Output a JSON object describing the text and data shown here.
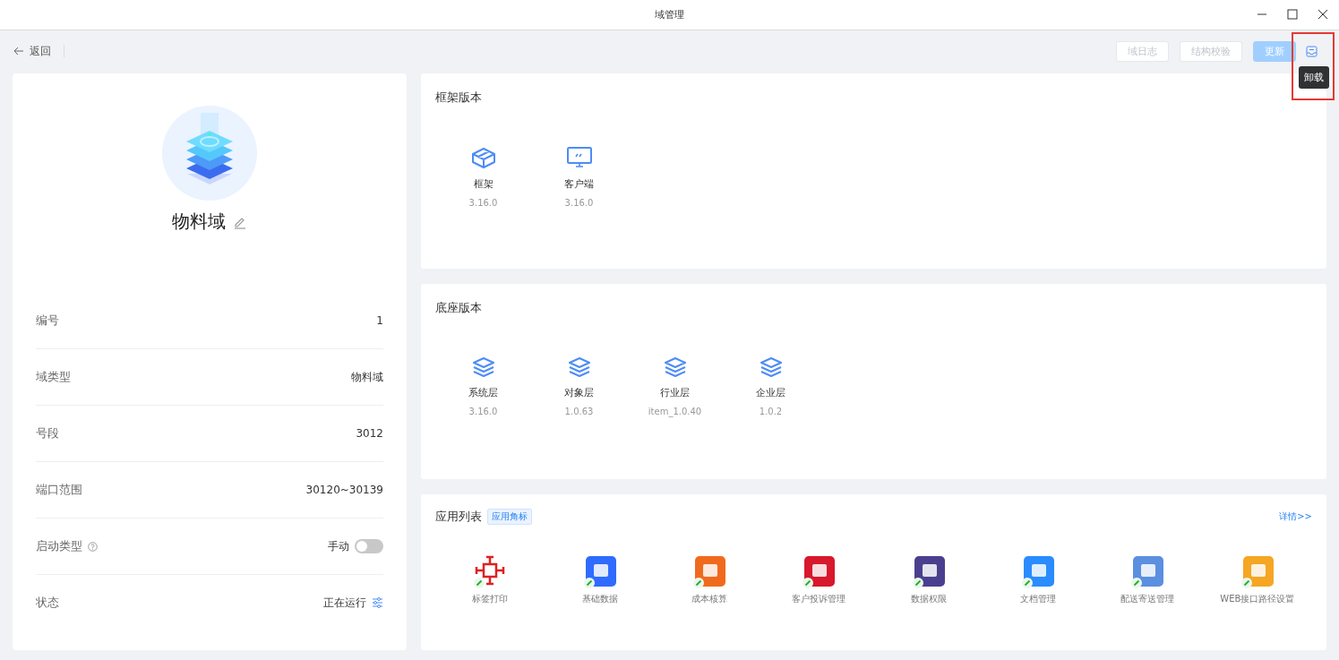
{
  "window": {
    "title": "域管理"
  },
  "toolbar": {
    "back": "返回",
    "buttons": [
      {
        "label": "域日志",
        "kind": "plain",
        "disabled": true
      },
      {
        "label": "结构校验",
        "kind": "plain",
        "disabled": true
      },
      {
        "label": "更新",
        "kind": "primary",
        "disabled": true
      }
    ],
    "tooltip": "卸载"
  },
  "domain": {
    "name": "物料域",
    "fields": [
      {
        "label": "编号",
        "value": "1",
        "kind": "text"
      },
      {
        "label": "域类型",
        "value": "物料域",
        "kind": "text"
      },
      {
        "label": "号段",
        "value": "3012",
        "kind": "text"
      },
      {
        "label": "端口范围",
        "value": "30120~30139",
        "kind": "text"
      },
      {
        "label": "启动类型",
        "value": "手动",
        "kind": "toggle",
        "on": false
      },
      {
        "label": "状态",
        "value": "正在运行",
        "kind": "status"
      }
    ]
  },
  "framework": {
    "title": "框架版本",
    "items": [
      {
        "name": "框架",
        "version": "3.16.0",
        "kind": "box"
      },
      {
        "name": "客户端",
        "version": "3.16.0",
        "kind": "monitor"
      }
    ]
  },
  "base": {
    "title": "底座版本",
    "items": [
      {
        "name": "系统层",
        "version": "3.16.0",
        "kind": "layers"
      },
      {
        "name": "对象层",
        "version": "1.0.63",
        "kind": "layers"
      },
      {
        "name": "行业层",
        "version": "item_1.0.40",
        "kind": "layers"
      },
      {
        "name": "企业层",
        "version": "1.0.2",
        "kind": "layers"
      }
    ]
  },
  "apps": {
    "title": "应用列表",
    "tag": "应用角标",
    "more": "详情>>",
    "items": [
      {
        "name": "标签打印",
        "color": "#e02020"
      },
      {
        "name": "基础数据",
        "color": "#2f6bff"
      },
      {
        "name": "成本核算",
        "color": "#f06a1e"
      },
      {
        "name": "客户投诉管理",
        "color": "#d8182c"
      },
      {
        "name": "数据权限",
        "color": "#4a3f8f"
      },
      {
        "name": "文档管理",
        "color": "#2a8cff"
      },
      {
        "name": "配送寄送管理",
        "color": "#5b8fe0"
      },
      {
        "name": "WEB接口路径设置",
        "color": "#f5a623"
      }
    ]
  }
}
